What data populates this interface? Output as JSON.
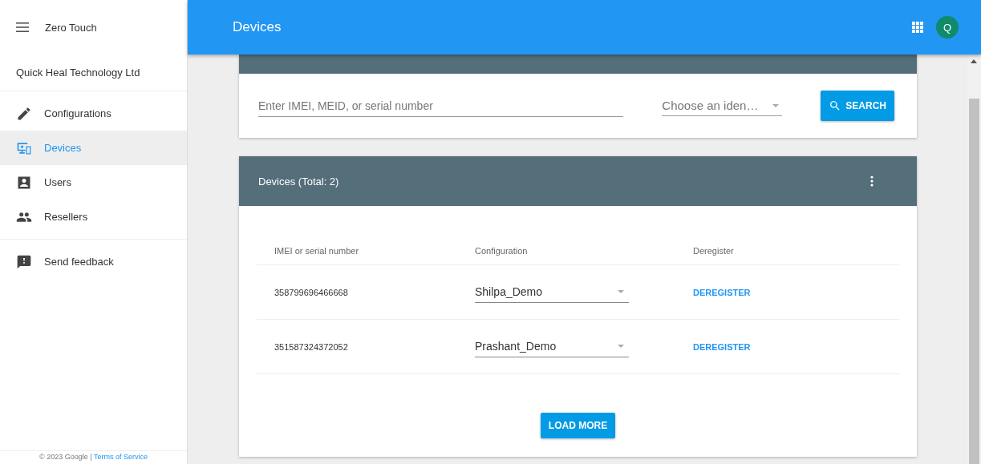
{
  "app": {
    "title": "Zero Touch"
  },
  "sidebar": {
    "organization": "Quick Heal Technology Ltd",
    "items": [
      {
        "label": "Configurations",
        "kind": "pencil",
        "selected": false
      },
      {
        "label": "Devices",
        "kind": "devices",
        "selected": true
      },
      {
        "label": "Users",
        "kind": "user",
        "selected": false
      },
      {
        "label": "Resellers",
        "kind": "people",
        "selected": false
      }
    ],
    "feedback": {
      "label": "Send feedback",
      "kind": "feedback"
    },
    "footer": {
      "copyright": "© 2023 Google |",
      "link": "Terms of Service"
    }
  },
  "header": {
    "title": "Devices",
    "avatar": "Q"
  },
  "search": {
    "placeholder": "Enter IMEI, MEID, or serial number",
    "identifier_placeholder": "Choose an iden…",
    "button": "SEARCH"
  },
  "devices": {
    "title": "Devices (Total: 2)",
    "columns": [
      "IMEI or serial number",
      "Configuration",
      "Deregister"
    ],
    "rows": [
      {
        "serial": "358799696466668",
        "configuration": "Shilpa_Demo",
        "action": "DEREGISTER"
      },
      {
        "serial": "351587324372052",
        "configuration": "Prashant_Demo",
        "action": "DEREGISTER"
      }
    ],
    "load_more": "LOAD MORE"
  }
}
